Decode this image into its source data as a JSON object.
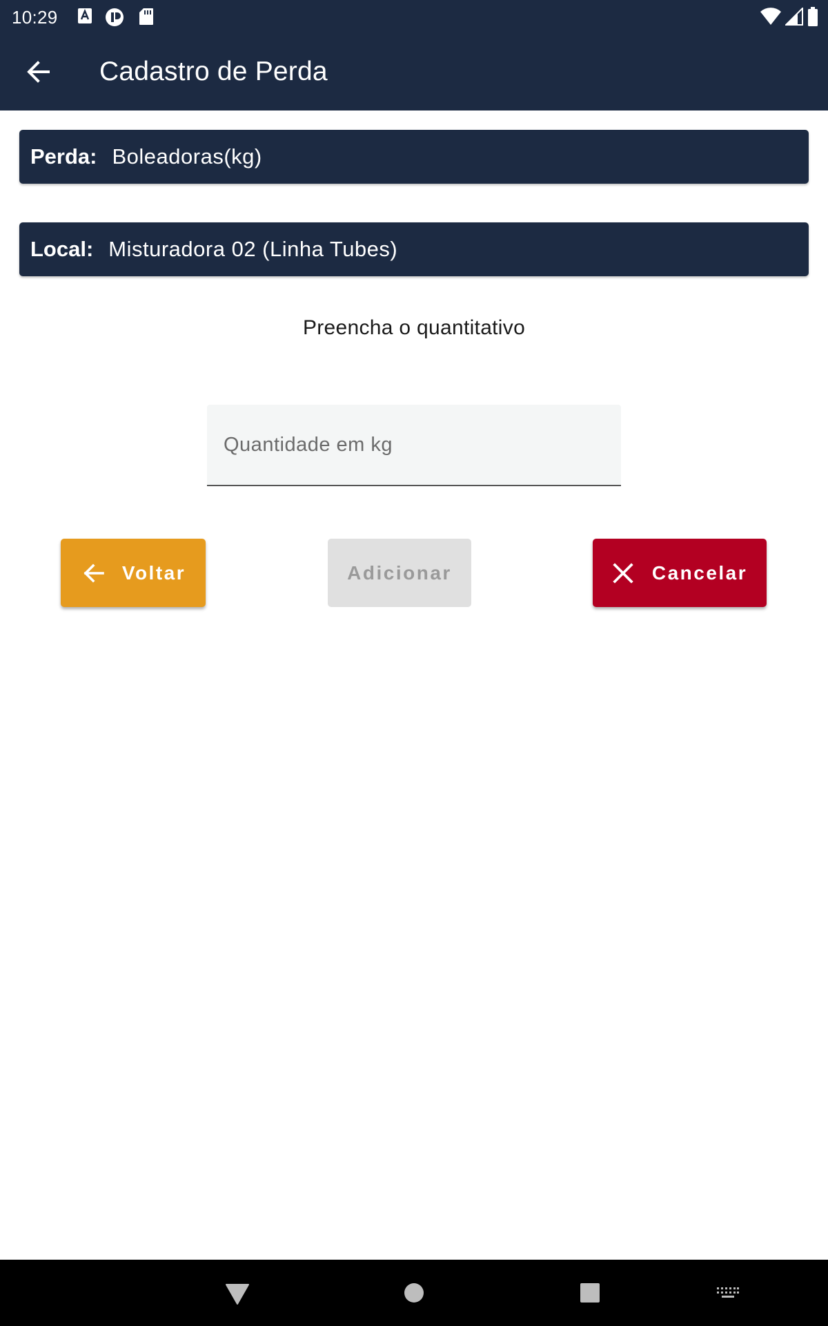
{
  "status_bar": {
    "time": "10:29",
    "icons": [
      "font-download-icon",
      "app-notification-icon",
      "sd-card-icon",
      "wifi-icon",
      "cell-signal-icon",
      "battery-icon"
    ]
  },
  "app_bar": {
    "title": "Cadastro de Perda",
    "back_icon": "arrow-back-icon"
  },
  "perda": {
    "label": "Perda:",
    "value": "Boleadoras(kg)"
  },
  "local": {
    "label": "Local:",
    "value": "Misturadora 02 (Linha Tubes)"
  },
  "prompt": "Preencha o quantitativo",
  "quantity_field": {
    "placeholder": "Quantidade em kg",
    "value": ""
  },
  "buttons": {
    "voltar": "Voltar",
    "adicionar": "Adicionar",
    "cancelar": "Cancelar"
  },
  "colors": {
    "primary": "#1c2a42",
    "voltar": "#e69b1e",
    "cancelar": "#b30022",
    "disabled": "#e0e0e0"
  },
  "nav_bar": {
    "icons": [
      "back-triangle-icon",
      "home-circle-icon",
      "recents-square-icon",
      "keyboard-icon"
    ]
  }
}
